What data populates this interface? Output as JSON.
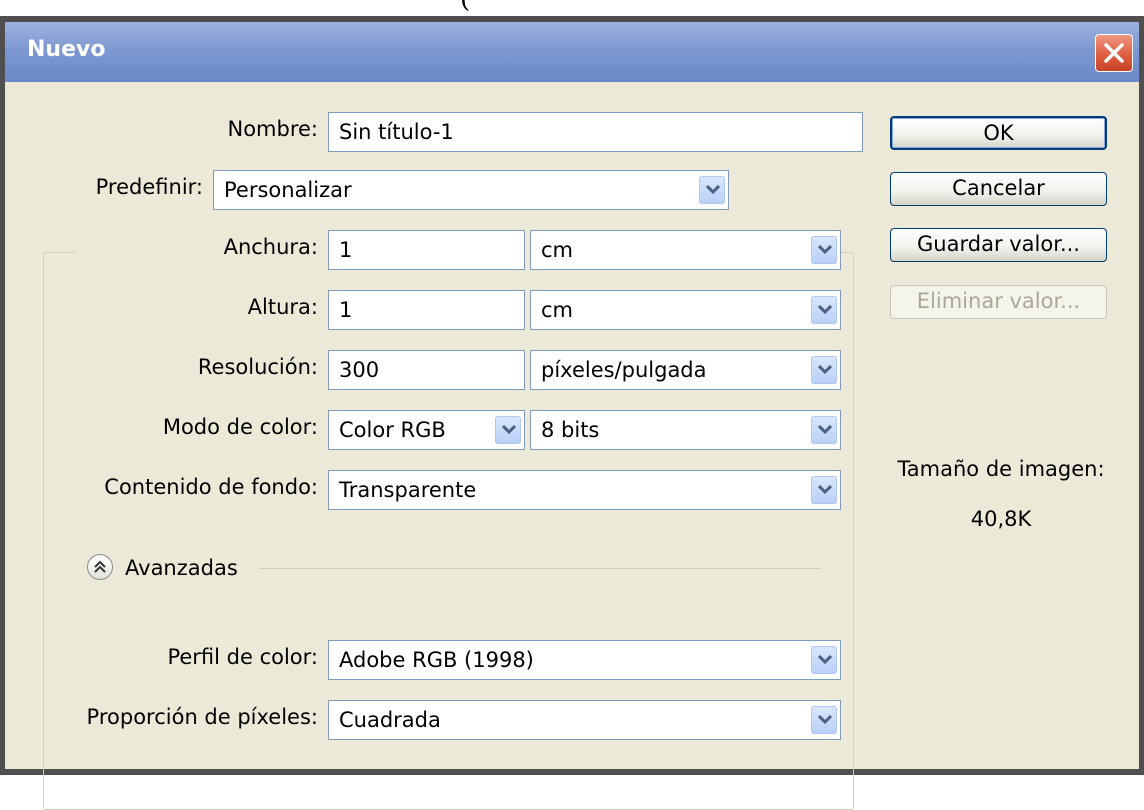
{
  "top_fragment": "(",
  "dialog": {
    "title": "Nuevo"
  },
  "form": {
    "nombre": {
      "label": "Nombre:",
      "value": "Sin título-1"
    },
    "predefinir": {
      "label": "Predefinir:",
      "value": "Personalizar"
    },
    "anchura": {
      "label": "Anchura:",
      "value": "1",
      "unit": "cm"
    },
    "altura": {
      "label": "Altura:",
      "value": "1",
      "unit": "cm"
    },
    "resolucion": {
      "label": "Resolución:",
      "value": "300",
      "unit": "píxeles/pulgada"
    },
    "modo_color": {
      "label": "Modo de color:",
      "value": "Color RGB",
      "bits": "8 bits"
    },
    "contenido_fondo": {
      "label": "Contenido de fondo:",
      "value": "Transparente"
    },
    "avanzadas": {
      "label": "Avanzadas"
    },
    "perfil_color": {
      "label": "Perfil de color:",
      "value": "Adobe RGB (1998)"
    },
    "proporcion_pixeles": {
      "label": "Proporción de píxeles:",
      "value": "Cuadrada"
    }
  },
  "buttons": {
    "ok": "OK",
    "cancelar": "Cancelar",
    "guardar": "Guardar valor...",
    "eliminar": "Eliminar valor..."
  },
  "image_size": {
    "label": "Tamaño de imagen:",
    "value": "40,8K"
  },
  "icons": {
    "close": "close-icon",
    "dropdown": "chevron-down-icon",
    "collapse": "double-chevron-up-icon"
  },
  "colors": {
    "titlebar": "#7e99d2",
    "client": "#ece9d8",
    "close": "#dd5a3c"
  }
}
